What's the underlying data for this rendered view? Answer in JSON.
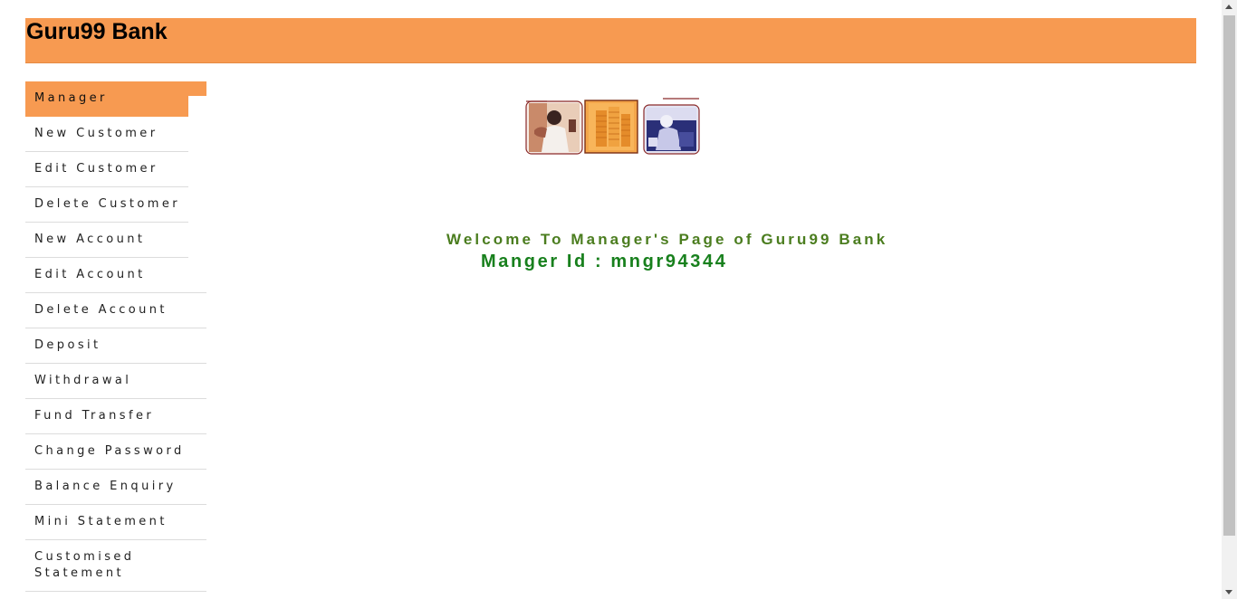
{
  "header": {
    "title": "Guru99 Bank",
    "accent": "#F79A51"
  },
  "menu": {
    "items": [
      {
        "label": "Manager",
        "active": true
      },
      {
        "label": "New Customer"
      },
      {
        "label": "Edit Customer"
      },
      {
        "label": "Delete Customer"
      },
      {
        "label": "New Account"
      },
      {
        "label": "Edit Account"
      },
      {
        "label": "Delete Account"
      },
      {
        "label": "Deposit"
      },
      {
        "label": "Withdrawal"
      },
      {
        "label": "Fund Transfer"
      },
      {
        "label": "Change Password"
      },
      {
        "label": "Balance Enquiry"
      },
      {
        "label": "Mini Statement"
      },
      {
        "label": "Customised Statement"
      }
    ]
  },
  "main": {
    "welcome": "Welcome To Manager's Page of Guru99 Bank",
    "manager_id": "Manger Id : mngr94344",
    "welcome_color": "#4b7d1f",
    "manager_id_color": "#18801d"
  }
}
